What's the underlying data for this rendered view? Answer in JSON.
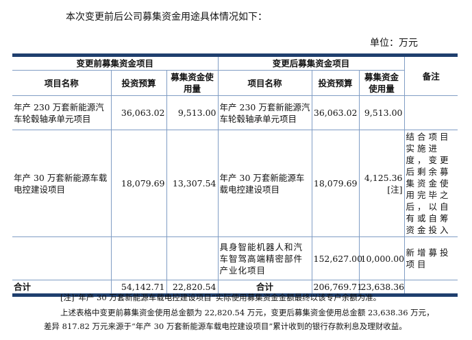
{
  "intro": "本次变更前后公司募集资金用途具体情况如下：",
  "unit": "单位：万元",
  "header": {
    "before": "变更前募集资金项目",
    "after": "变更后募集资金项目",
    "remark": "备注",
    "name": "项目名称",
    "budget": "投资预算",
    "used_before": "募集资金使用量",
    "used_after": "募集资金使用量"
  },
  "rows": [
    {
      "b_name": "年产 230 万套新能源汽车轮毂轴承单元项目",
      "b_budget": "36,063.02",
      "b_used": "9,513.00",
      "a_name": "年产 230 万套新能源汽车轮毂轴承单元项目",
      "a_budget": "36,063.02",
      "a_used": "9,513.00",
      "remark": ""
    },
    {
      "b_name": "年产 30 万套新能源车载电控建设项目",
      "b_budget": "18,079.69",
      "b_used": "13,307.54",
      "a_name": "年产 30 万套新能源车载电控建设项目",
      "a_budget": "18,079.69",
      "a_used": "4,125.36",
      "a_used_note": "[注]",
      "remark": "结合项目实施进度，变更后剩余募集资金使用完毕之后，以自有或自筹资金投入"
    },
    {
      "b_name": "",
      "b_budget": "",
      "b_used": "",
      "a_name": "具身智能机器人和汽车智驾高端精密部件产业化项目",
      "a_budget": "152,627.00",
      "a_used": "10,000.00",
      "remark": "新增募投项目"
    }
  ],
  "total": {
    "label": "合计",
    "b_budget": "54,142.71",
    "b_used": "22,820.54",
    "label2": "合计",
    "a_budget": "206,769.71",
    "a_used": "23,638.36"
  },
  "notes": [
    "[注]“年产 30 万套新能源车载电控建设项目”实际使用募集资金金额最终以该专户余额为准。",
    "上述表格中变更前募集资金使用总金额为 22,820.54 万元，变更后募集资金使用总金额 23,638.36 万元，",
    "差异 817.82 万元来源于“年产 30 万套新能源车载电控建设项目”累计收到的银行存款利息及理财收益。"
  ]
}
